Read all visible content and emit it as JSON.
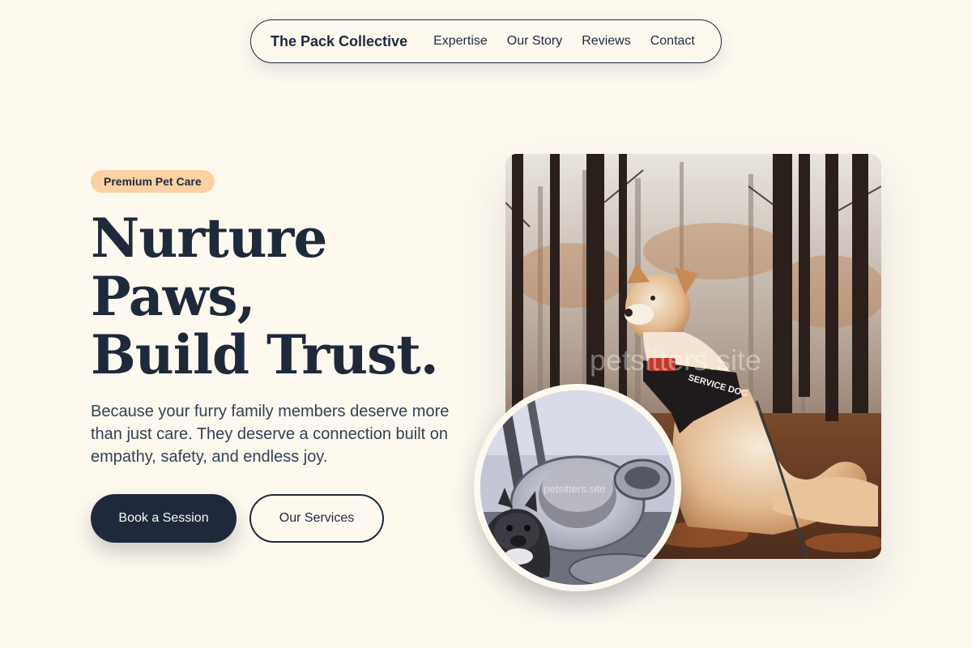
{
  "nav": {
    "brand": "The Pack Collective",
    "links": [
      "Expertise",
      "Our Story",
      "Reviews",
      "Contact"
    ]
  },
  "hero": {
    "badge": "Premium Pet Care",
    "headline_lines": [
      "Nurture",
      "Paws,",
      "Build Trust."
    ],
    "subtext": "Because your furry family members deserve more than just care. They deserve a connection built on empathy, safety, and endless joy.",
    "primary_cta": "Book a Session",
    "secondary_cta": "Our Services"
  },
  "images": {
    "main_watermark": "petsitters.site",
    "circle_watermark": "petsitters.site",
    "main_harness_text": "SERVICE DOG"
  },
  "colors": {
    "background": "#fdf9ef",
    "navy": "#1e293b",
    "badge": "#fcd1a2"
  }
}
